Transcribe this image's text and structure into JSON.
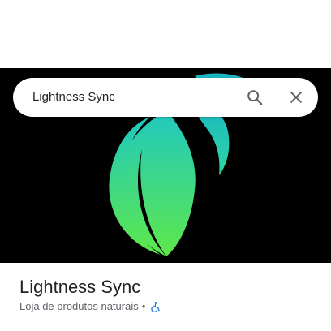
{
  "search": {
    "query": "Lightness Sync"
  },
  "place": {
    "name": "Lightness Sync",
    "category": "Loja de produtos naturais",
    "separator": "•"
  },
  "icons": {
    "search": "search-icon",
    "close": "close-icon",
    "accessibility": "wheelchair-accessible-icon"
  },
  "colors": {
    "hero_background": "#000000",
    "logo_gradient_top": "#1fc8c0",
    "logo_gradient_bottom": "#5ee84a",
    "accessibility_icon": "#1a73e8",
    "text_primary": "#202124",
    "text_secondary": "#5f6368"
  }
}
